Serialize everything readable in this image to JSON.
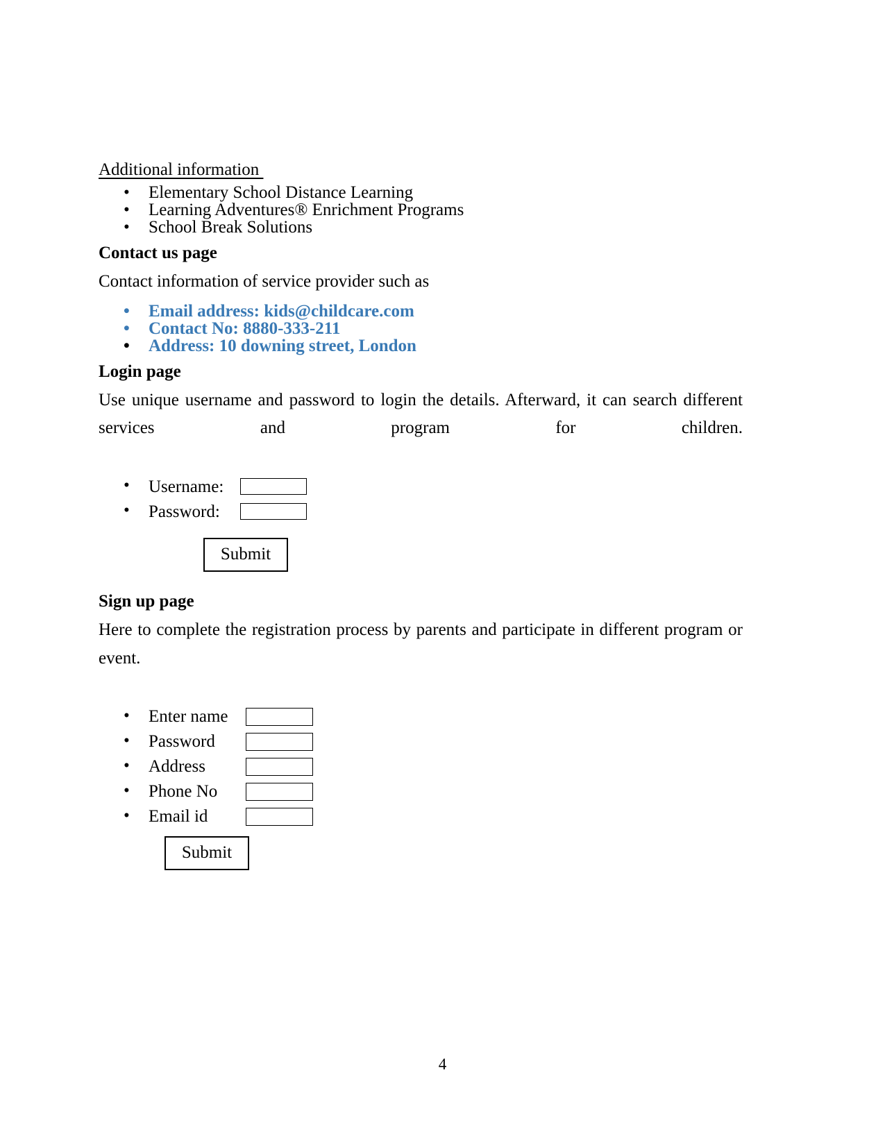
{
  "document": {
    "page_number": "4",
    "colors": {
      "text": "#000000",
      "accent_blue": "#3a7ab5",
      "background": "#ffffff"
    }
  },
  "additional_information": {
    "heading": "Additional information ",
    "items": [
      {
        "bullet": "•",
        "label": "Elementary School Distance Learning"
      },
      {
        "bullet": "•",
        "label": "Learning Adventures® Enrichment Programs"
      },
      {
        "bullet": "•",
        "label": "School Break Solutions"
      }
    ]
  },
  "contact_us": {
    "heading": "Contact us page",
    "intro": "Contact information of service provider such as",
    "items": [
      {
        "bullet": "•",
        "label": "Email address: kids@childcare.com",
        "bullet_color": "blue"
      },
      {
        "bullet": "•",
        "label": "Contact No: 8880-333-211",
        "bullet_color": "blue"
      },
      {
        "bullet": "•",
        "label": "Address: 10 downing street, London",
        "bullet_color": "black"
      }
    ]
  },
  "login_page": {
    "heading": "Login page",
    "description": "Use unique username and password to login the details. Afterward, it can search different services and program for children.",
    "fields": [
      {
        "bullet": "•",
        "label": "Username:",
        "value": "",
        "placeholder": ""
      },
      {
        "bullet": "•",
        "label": "Password:",
        "value": "",
        "placeholder": ""
      }
    ],
    "submit_label": "Submit"
  },
  "signup_page": {
    "heading": "Sign up page",
    "description": "Here to complete the registration process by parents and participate in different program or event.",
    "fields": [
      {
        "bullet": "•",
        "label": "Enter name",
        "value": "",
        "placeholder": ""
      },
      {
        "bullet": "•",
        "label": "Password",
        "value": "",
        "placeholder": ""
      },
      {
        "bullet": "•",
        "label": "Address",
        "value": "",
        "placeholder": ""
      },
      {
        "bullet": "•",
        "label": "Phone No",
        "value": "",
        "placeholder": ""
      },
      {
        "bullet": "•",
        "label": "Email id",
        "value": "",
        "placeholder": ""
      }
    ],
    "submit_label": "Submit"
  }
}
